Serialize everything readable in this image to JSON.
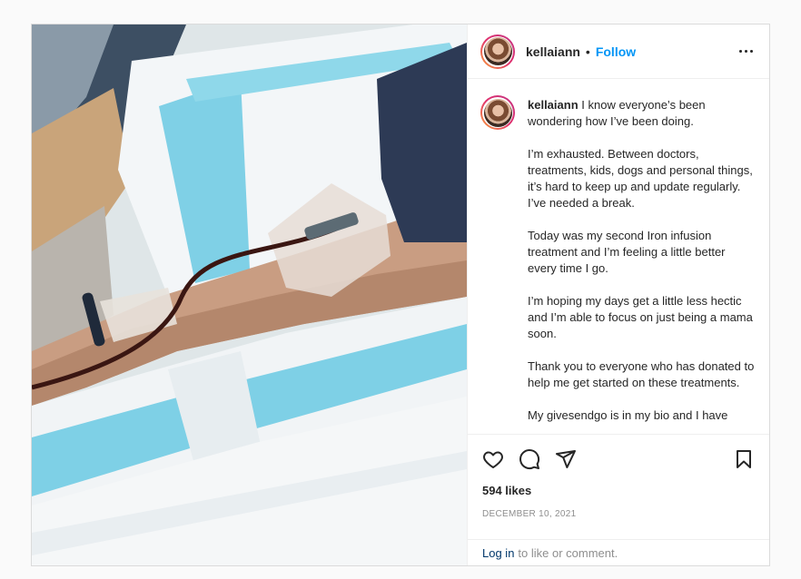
{
  "post": {
    "username": "kellaiann",
    "separator": "•",
    "follow_label": "Follow",
    "caption_username": "kellaiann",
    "caption": "I know everyone’s been wondering how I’ve been doing.\n\nI’m exhausted. Between doctors, treatments, kids, dogs and personal things, it’s hard to keep up and update regularly. I’ve needed a break.\n\nToday was my second Iron infusion treatment and I’m feeling a little better every time I go.\n\nI’m hoping my days get a little less hectic and I’m able to focus on just being a mama soon.\n\nThank you to everyone who has donated to help me get started on these treatments.\n\nMy givesendgo is in my bio and I have",
    "likes": "594 likes",
    "date": "December 10, 2021",
    "login_link": "Log in",
    "login_suffix": "to like or comment."
  },
  "icons": {
    "like": "heart-icon",
    "comment": "comment-icon",
    "share": "paper-plane-icon",
    "save": "bookmark-icon",
    "more": "more-options-icon"
  },
  "colors": {
    "accent": "#0095f6",
    "text": "#262626",
    "muted": "#8e8e8e",
    "link": "#00376b",
    "border": "#dbdbdb"
  }
}
